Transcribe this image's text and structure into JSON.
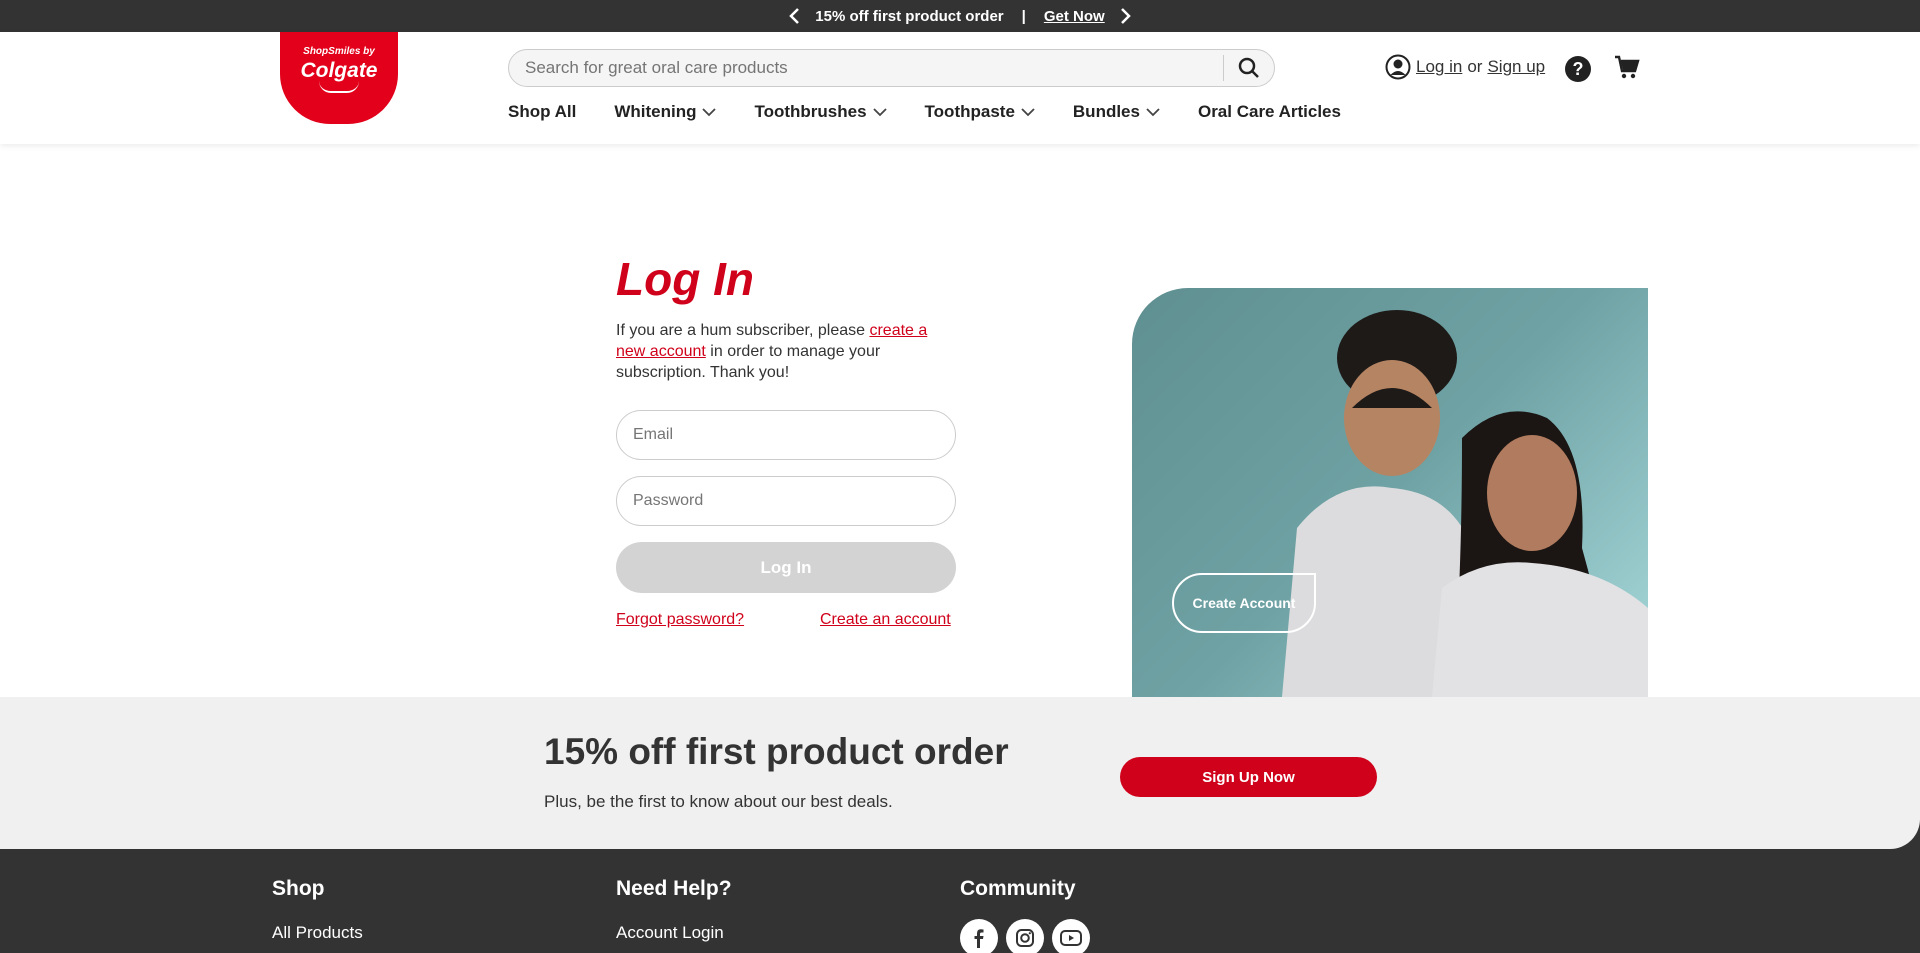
{
  "promo": {
    "text": "15% off first product order",
    "separator": "|",
    "link": "Get Now"
  },
  "logo": {
    "tagline": "ShopSmiles by",
    "brand": "Colgate"
  },
  "search": {
    "placeholder": "Search for great oral care products"
  },
  "account": {
    "login": "Log in",
    "or": "or",
    "signup": "Sign up"
  },
  "nav": {
    "items": [
      {
        "label": "Shop All"
      },
      {
        "label": "Whitening"
      },
      {
        "label": "Toothbrushes"
      },
      {
        "label": "Toothpaste"
      },
      {
        "label": "Bundles"
      },
      {
        "label": "Oral Care Articles"
      }
    ]
  },
  "login": {
    "title": "Log In",
    "note_before": "If you are a hum subscriber, please ",
    "note_link": "create a new account",
    "note_after": " in order to manage your subscription. Thank you!",
    "email_placeholder": "Email",
    "password_placeholder": "Password",
    "button": "Log In",
    "forgot": "Forgot password?",
    "create": "Create an account"
  },
  "hero": {
    "button": "Create Account"
  },
  "banner": {
    "title": "15% off first product order",
    "subtitle": "Plus, be the first to know about our best deals.",
    "button": "Sign Up Now"
  },
  "footer": {
    "columns": [
      {
        "title": "Shop",
        "link": "All Products"
      },
      {
        "title": "Need Help?",
        "link": "Account Login"
      },
      {
        "title": "Community"
      }
    ]
  },
  "colors": {
    "brand_red": "#e2001a",
    "link_red": "#d0021b",
    "dark": "#333333"
  }
}
